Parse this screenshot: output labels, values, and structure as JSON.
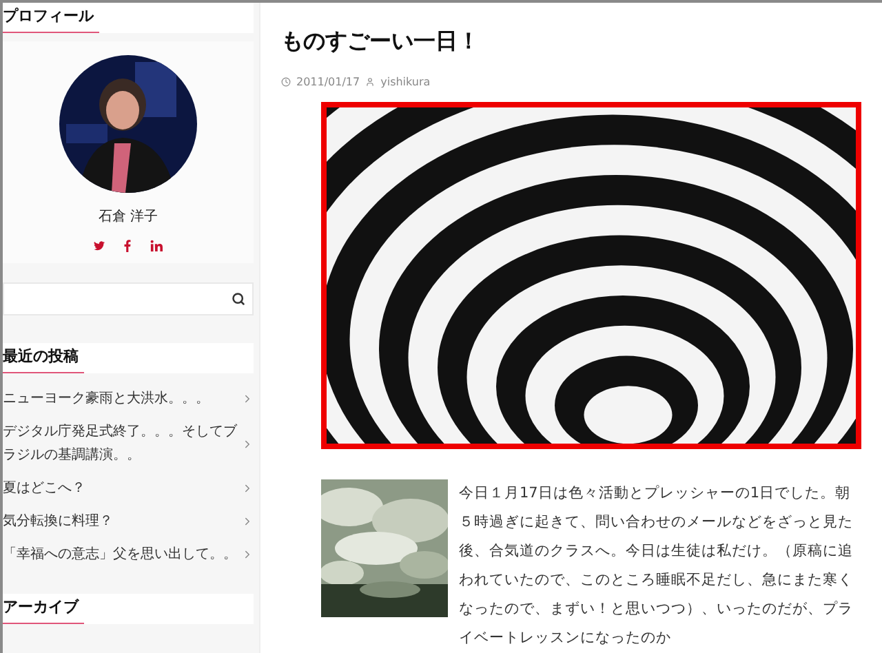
{
  "sidebar": {
    "profile": {
      "heading": "プロフィール",
      "name": "石倉 洋子",
      "social": [
        {
          "kind": "twitter"
        },
        {
          "kind": "facebook"
        },
        {
          "kind": "linkedin"
        }
      ]
    },
    "recent_posts": {
      "heading": "最近の投稿",
      "items": [
        {
          "title": "ニューヨーク豪雨と大洪水。。。"
        },
        {
          "title": "デジタル庁発足式終了。。。そしてブラジルの基調講演。。"
        },
        {
          "title": "夏はどこへ？"
        },
        {
          "title": "気分転換に料理？"
        },
        {
          "title": "「幸福への意志」父を思い出して。。"
        }
      ]
    },
    "archive": {
      "heading": "アーカイブ"
    }
  },
  "post": {
    "title": "ものすごーい一日！",
    "date": "2011/01/17",
    "author": "yishikura",
    "body": "今日１月17日は色々活動とプレッシャーの1日でした。朝５時過ぎに起きて、問い合わせのメールなどをざっと見た後、合気道のクラスへ。今日は生徒は私だけ。（原稿に追われていたので、このところ睡眠不足だし、急にまた寒くなったので、まずい！と思いつつ）、いったのだが、プライベートレッスンになったのか"
  }
}
